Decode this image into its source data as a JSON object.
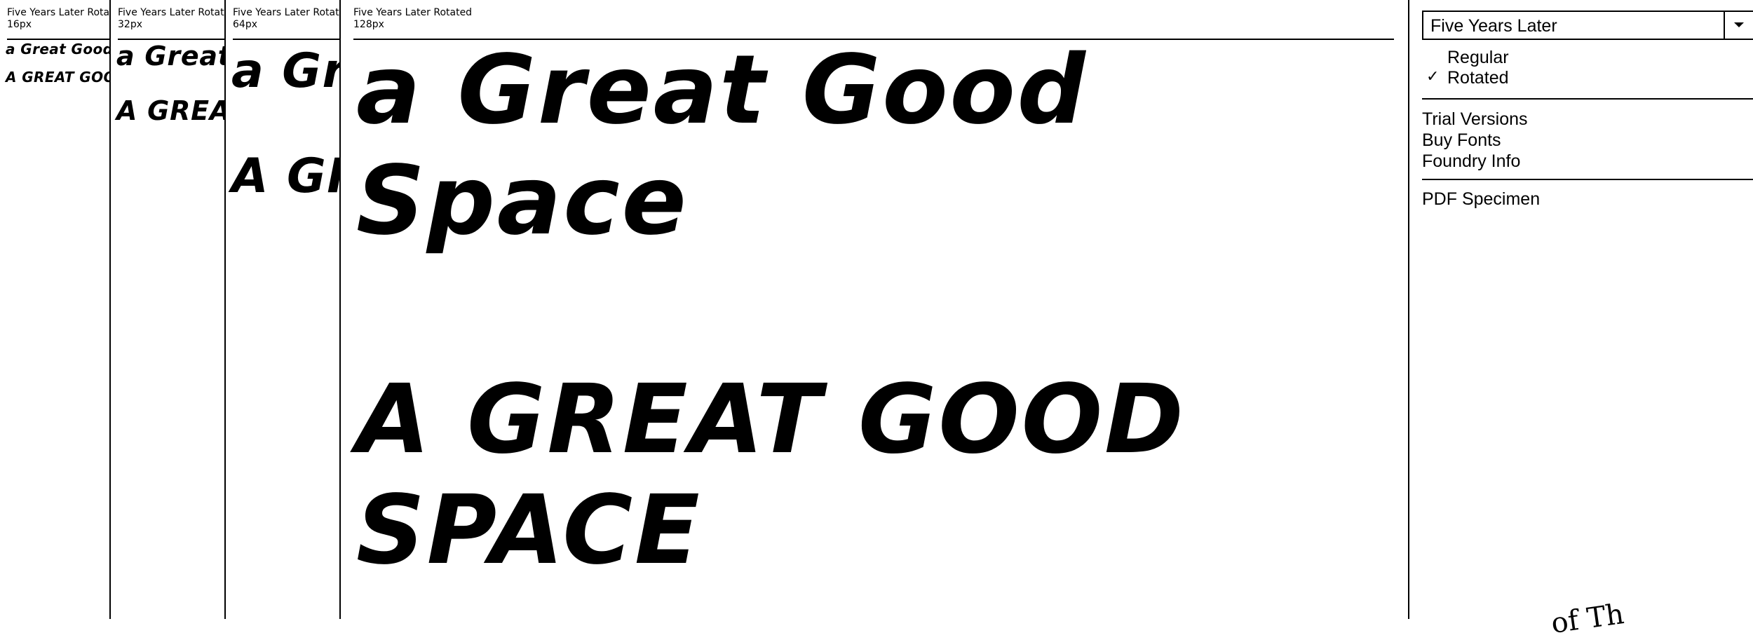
{
  "sample_lines": [
    "a Great Good Space",
    "a GREAT GOOD SPACE"
  ],
  "panels": [
    {
      "title": "Five Years Later Rotated",
      "size": "16px"
    },
    {
      "title": "Five Years Later Rotated",
      "size": "32px"
    },
    {
      "title": "Five Years Later Rotated",
      "size": "64px"
    },
    {
      "title": "Five Years Later Rotated",
      "size": "128px"
    }
  ],
  "sidebar": {
    "font_select_value": "Five Years Later",
    "styles": [
      {
        "label": "Regular",
        "checked": false
      },
      {
        "label": "Rotated",
        "checked": true,
        "mark": "✓"
      }
    ],
    "links": [
      "Trial Versions",
      "Buy Fonts",
      "Foundry Info"
    ],
    "pdf_link": "PDF Specimen",
    "footer_fragment": "of Th"
  }
}
